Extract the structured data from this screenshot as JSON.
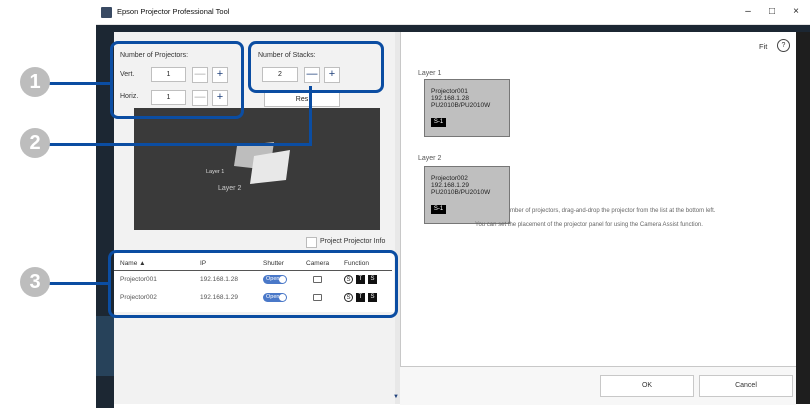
{
  "window": {
    "title": "Epson Projector Professional Tool",
    "minimize": "–",
    "maximize": "□",
    "close": "×"
  },
  "layout_panel": {
    "projectors_title": "Number of Projectors:",
    "vert_label": "Vert.",
    "vert_value": "1",
    "horiz_label": "Horiz.",
    "horiz_value": "1",
    "stacks_title": "Number of Stacks:",
    "stacks_value": "2",
    "reset_label": "Res",
    "minus": "—",
    "plus": "+",
    "preview_layer_top": "Layer 1",
    "preview_layer_bottom": "Layer 2",
    "project_info_label": "Project Projector Info"
  },
  "callouts": [
    "1",
    "2",
    "3"
  ],
  "table": {
    "headers": [
      "Name ▲",
      "IP",
      "Shutter",
      "Camera",
      "Function"
    ],
    "rows": [
      {
        "name": "Projector001",
        "ip": "192.168.1.28",
        "shutter": "Open"
      },
      {
        "name": "Projector002",
        "ip": "192.168.1.29",
        "shutter": "Open"
      }
    ],
    "fn_s": "S",
    "fn_t": "T",
    "fn_s2": "S"
  },
  "right_panel": {
    "fit_label": "Fit",
    "help": "?",
    "layer1": "Layer 1",
    "layer2": "Layer 2",
    "cards": [
      {
        "name": "Projector001",
        "ip": "192.168.1.28",
        "model": "PU2010B/PU2010W",
        "tag": "S-1"
      },
      {
        "name": "Projector002",
        "ip": "192.168.1.29",
        "model": "PU2010B/PU2010W",
        "tag": "S-1"
      }
    ],
    "hint1": "mber of projectors, drag-and-drop the projector from the list at the bottom left.",
    "hint2": "You can set the placement of the projector panel for using the Camera Assist function."
  },
  "footer": {
    "ok": "OK",
    "cancel": "Cancel"
  },
  "colors": {
    "callout_blue": "#0b4da2",
    "toggle_blue": "#4a78c8"
  }
}
